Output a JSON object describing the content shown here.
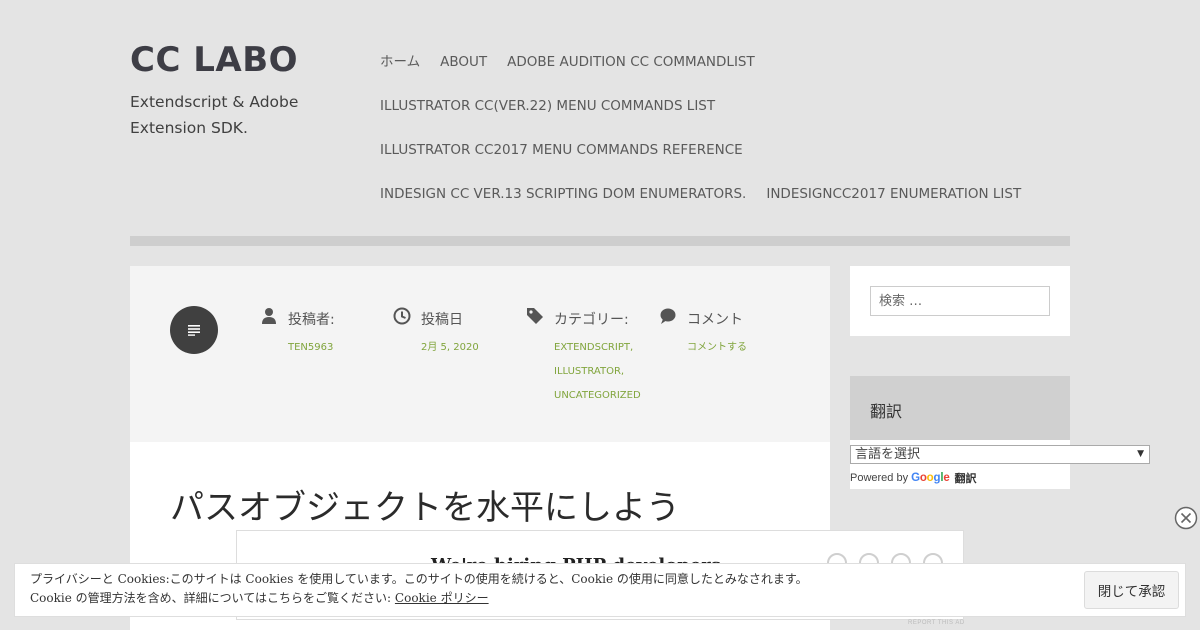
{
  "site": {
    "title": "CC LABO",
    "description": "Extendscript & Adobe Extension SDK."
  },
  "nav": {
    "items": [
      {
        "label": "ホーム"
      },
      {
        "label": "ABOUT"
      },
      {
        "label": "ADOBE AUDITION CC COMMANDLIST"
      },
      {
        "label": "ILLUSTRATOR CC(VER.22) MENU COMMANDS LIST"
      },
      {
        "label": "ILLUSTRATOR CC2017 MENU COMMANDS REFERENCE"
      },
      {
        "label": "INDESIGN CC VER.13 SCRIPTING DOM ENUMERATORS."
      },
      {
        "label": "INDESIGNCC2017 ENUMERATION LIST"
      }
    ]
  },
  "post": {
    "format_icon": "text-format-icon",
    "meta": {
      "author": {
        "label": "投稿者:",
        "value": "TEN5963",
        "icon": "person-icon"
      },
      "date": {
        "label": "投稿日",
        "value": "2月 5, 2020",
        "icon": "clock-icon"
      },
      "categories": {
        "label": "カテゴリー:",
        "values": [
          "EXTENDSCRIPT,",
          "ILLUSTRATOR,",
          "UNCATEGORIZED"
        ],
        "icon": "tag-icon"
      },
      "comments": {
        "label": "コメント",
        "value": "コメントする",
        "icon": "speech-bubble-icon"
      }
    },
    "title": "パスオブジェクトを水平にしよう"
  },
  "sidebar": {
    "search": {
      "placeholder": "検索 …"
    },
    "translate": {
      "title": "翻訳",
      "select_value": "言語を選択",
      "powered_by": "Powered by",
      "google": "Google",
      "translate_label": "翻訳"
    }
  },
  "ad": {
    "headline": "We're hiring PHP developers",
    "report": "REPORT THIS AD"
  },
  "cookie": {
    "line1": "プライバシーと Cookies:このサイトは Cookies を使用しています。このサイトの使用を続けると、Cookie の使用に同意したとみなされます。",
    "line2": "Cookie の管理方法を含め、詳細についてはこちらをご覧ください: ",
    "policy_link": "Cookie ポリシー",
    "accept_label": "閉じて承認"
  },
  "colors": {
    "background": "#e4e4e4",
    "accent_green": "#81a53d",
    "title_dark": "#3d3d45"
  }
}
